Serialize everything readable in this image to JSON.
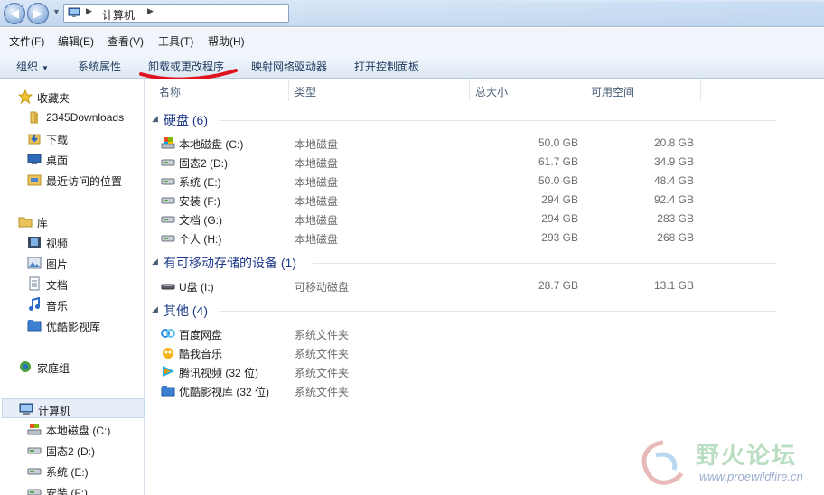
{
  "address": {
    "path": [
      "计算机"
    ]
  },
  "menu": [
    "文件(F)",
    "编辑(E)",
    "查看(V)",
    "工具(T)",
    "帮助(H)"
  ],
  "toolbar": {
    "organize": "组织",
    "system_properties": "系统属性",
    "uninstall": "卸载或更改程序",
    "map_drive": "映射网络驱动器",
    "control_panel": "打开控制面板"
  },
  "sidebar": {
    "favorites": {
      "label": "收藏夹",
      "items": [
        "2345Downloads",
        "下载",
        "桌面",
        "最近访问的位置"
      ]
    },
    "libraries": {
      "label": "库",
      "items": [
        "视频",
        "图片",
        "文档",
        "音乐",
        "优酷影视库"
      ]
    },
    "homegroup": "家庭组",
    "computer": {
      "label": "计算机",
      "items": [
        "本地磁盘 (C:)",
        "固态2 (D:)",
        "系统 (E:)",
        "安装 (F:)"
      ]
    }
  },
  "columns": [
    "名称",
    "类型",
    "总大小",
    "可用空间"
  ],
  "groups": [
    {
      "title": "硬盘 (6)",
      "rows": [
        {
          "name": "本地磁盘 (C:)",
          "type": "本地磁盘",
          "total": "50.0 GB",
          "free": "20.8 GB",
          "icon": "system-drive-icon"
        },
        {
          "name": "固态2 (D:)",
          "type": "本地磁盘",
          "total": "61.7 GB",
          "free": "34.9 GB",
          "icon": "drive-icon"
        },
        {
          "name": "系统 (E:)",
          "type": "本地磁盘",
          "total": "50.0 GB",
          "free": "48.4 GB",
          "icon": "drive-icon"
        },
        {
          "name": "安装 (F:)",
          "type": "本地磁盘",
          "total": "294 GB",
          "free": "92.4 GB",
          "icon": "drive-icon"
        },
        {
          "name": "文档 (G:)",
          "type": "本地磁盘",
          "total": "294 GB",
          "free": "283 GB",
          "icon": "drive-icon"
        },
        {
          "name": "个人 (H:)",
          "type": "本地磁盘",
          "total": "293 GB",
          "free": "268 GB",
          "icon": "drive-icon"
        }
      ]
    },
    {
      "title": "有可移动存储的设备 (1)",
      "rows": [
        {
          "name": "U盘 (I:)",
          "type": "可移动磁盘",
          "total": "28.7 GB",
          "free": "13.1 GB",
          "icon": "usb-drive-icon"
        }
      ]
    },
    {
      "title": "其他 (4)",
      "rows": [
        {
          "name": "百度网盘",
          "type": "系统文件夹",
          "total": "",
          "free": "",
          "icon": "baidu-netdisk-icon"
        },
        {
          "name": "酷我音乐",
          "type": "系统文件夹",
          "total": "",
          "free": "",
          "icon": "kuwo-music-icon"
        },
        {
          "name": "腾讯视频 (32 位)",
          "type": "系统文件夹",
          "total": "",
          "free": "",
          "icon": "tencent-video-icon"
        },
        {
          "name": "优酷影视库 (32 位)",
          "type": "系统文件夹",
          "total": "",
          "free": "",
          "icon": "youku-library-icon"
        }
      ]
    }
  ],
  "watermark": {
    "text": "野火论坛",
    "url": "www.proewildfire.cn"
  },
  "colors": {
    "group_title": "#1e3a8a",
    "annotation_red": "#e0141e",
    "toolbar_text": "#1e3a5f"
  }
}
